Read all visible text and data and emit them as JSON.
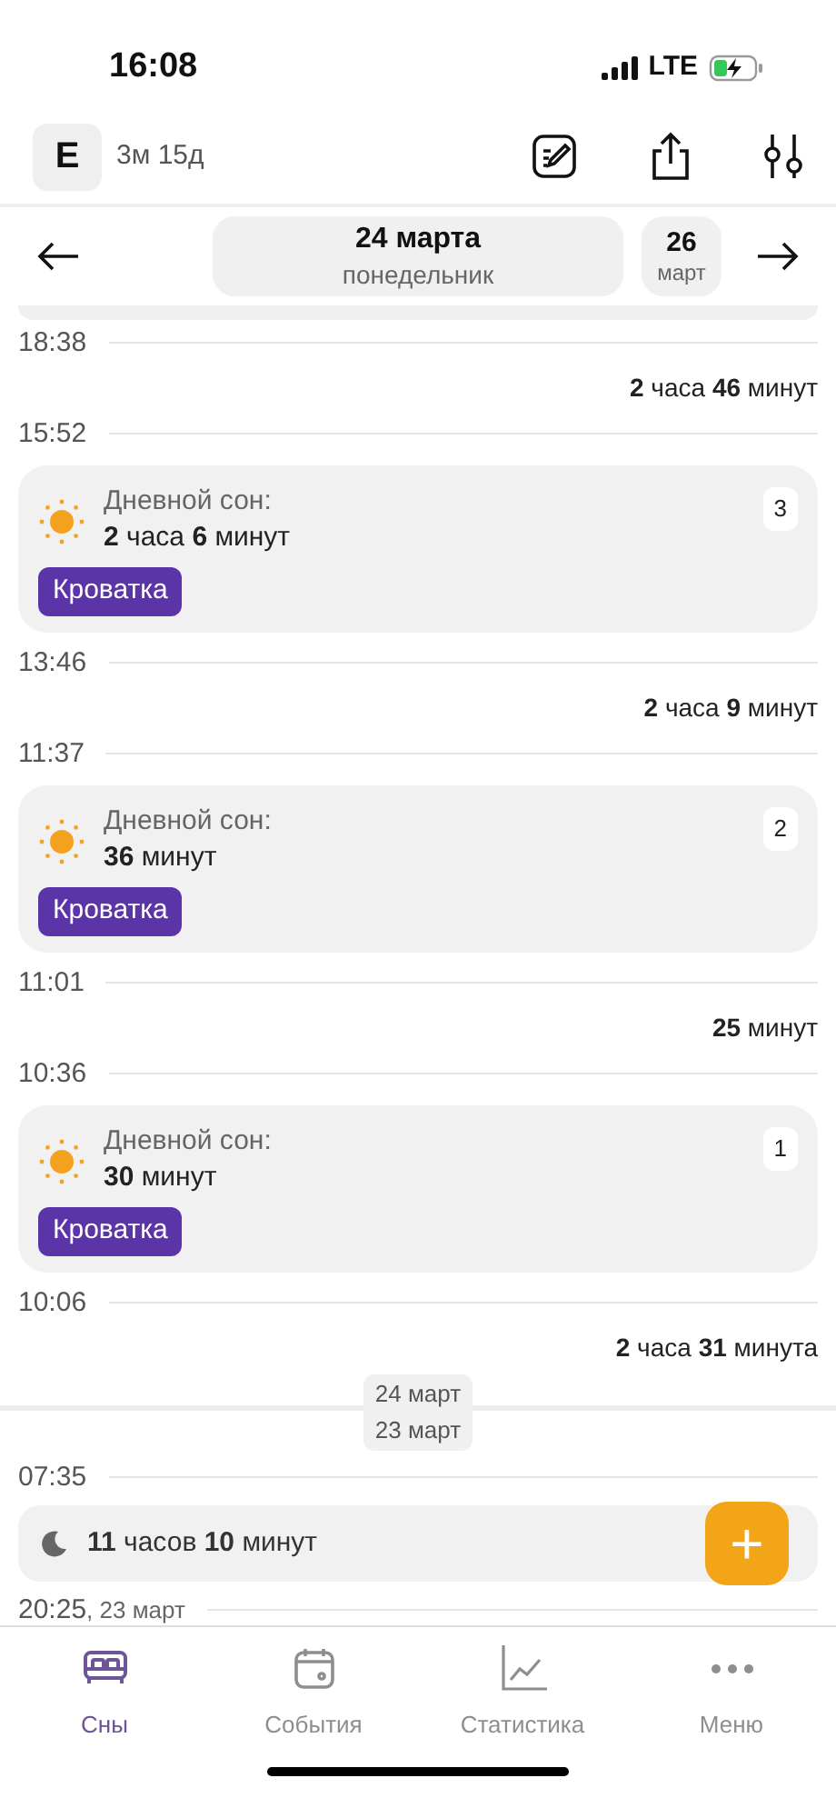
{
  "status_bar": {
    "time": "16:08",
    "network": "LTE"
  },
  "header": {
    "avatar": "E",
    "age": "3м 15д"
  },
  "date_nav": {
    "date": "24 марта",
    "weekday": "понедельник",
    "next_day": "26",
    "next_month": "март"
  },
  "timeline": [
    {
      "kind": "edge"
    },
    {
      "kind": "time",
      "time": "18:38"
    },
    {
      "kind": "gap",
      "text": "**2** часа **46** минут"
    },
    {
      "kind": "time",
      "time": "15:52"
    },
    {
      "kind": "nap",
      "label": "Дневной сон:",
      "duration": "**2** часа **6** минут",
      "place": "Кроватка",
      "number": "3"
    },
    {
      "kind": "time",
      "time": "13:46"
    },
    {
      "kind": "gap",
      "text": "**2** часа **9** минут"
    },
    {
      "kind": "time",
      "time": "11:37"
    },
    {
      "kind": "nap",
      "label": "Дневной сон:",
      "duration": "**36** минут",
      "place": "Кроватка",
      "number": "2"
    },
    {
      "kind": "time",
      "time": "11:01"
    },
    {
      "kind": "gap",
      "text": "**25** минут"
    },
    {
      "kind": "time",
      "time": "10:36"
    },
    {
      "kind": "nap",
      "label": "Дневной сон:",
      "duration": "**30** минут",
      "place": "Кроватка",
      "number": "1"
    },
    {
      "kind": "time",
      "time": "10:06"
    },
    {
      "kind": "gap",
      "text": "**2** часа **31** минута"
    },
    {
      "kind": "day_divider",
      "upper": "24 март",
      "lower": "23 март"
    },
    {
      "kind": "time",
      "time": "07:35"
    },
    {
      "kind": "night",
      "duration": "**11** часов **10** минут"
    },
    {
      "kind": "time",
      "time": "20:25",
      "date": ", 23 март"
    }
  ],
  "fab": {
    "label": "+"
  },
  "tabs": [
    {
      "label": "Сны",
      "selected": true
    },
    {
      "label": "События",
      "selected": false
    },
    {
      "label": "Статистика",
      "selected": false
    },
    {
      "label": "Меню",
      "selected": false
    }
  ]
}
